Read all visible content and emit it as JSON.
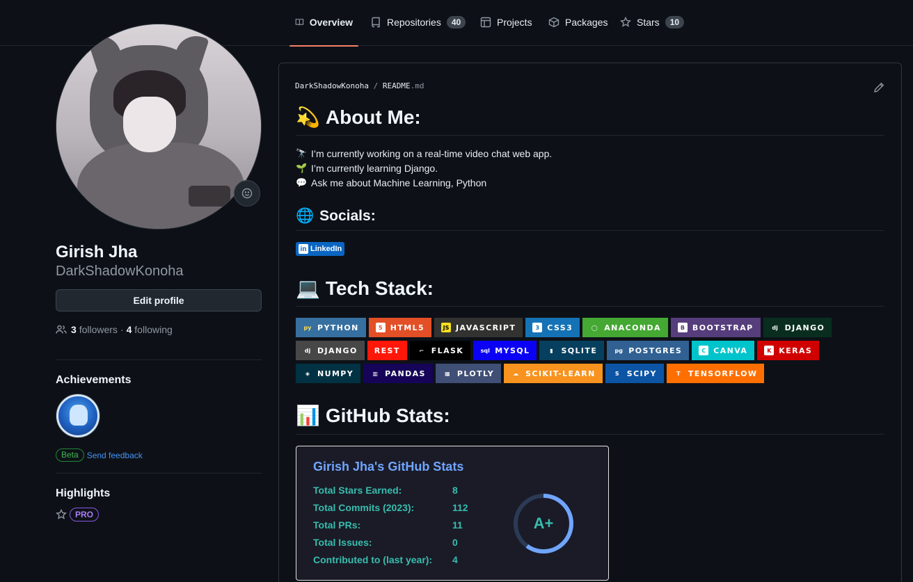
{
  "nav": {
    "tabs": [
      {
        "label": "Overview",
        "icon": "book-icon",
        "active": true
      },
      {
        "label": "Repositories",
        "icon": "repo-icon",
        "count": "40"
      },
      {
        "label": "Projects",
        "icon": "table-icon"
      },
      {
        "label": "Packages",
        "icon": "package-icon"
      },
      {
        "label": "Stars",
        "icon": "star-icon",
        "count": "10"
      }
    ]
  },
  "profile": {
    "name": "Girish Jha",
    "login": "DarkShadowKonoha",
    "edit_label": "Edit profile",
    "followers_count": "3",
    "followers_label": "followers",
    "separator": "·",
    "following_count": "4",
    "following_label": "following"
  },
  "achievements": {
    "heading": "Achievements",
    "beta_label": "Beta",
    "feedback_label": "Send feedback"
  },
  "highlights": {
    "heading": "Highlights",
    "pro_label": "PRO"
  },
  "readme": {
    "path_user": "DarkShadowKonoha",
    "path_sep": "/",
    "path_file": "README",
    "path_ext": ".md",
    "about_heading": "About Me:",
    "about_emoji": "💫",
    "lines": [
      {
        "icon": "🔭",
        "text": "I’m currently working on a real-time video chat web app."
      },
      {
        "icon": "🌱",
        "text": "I’m currently learning Django."
      },
      {
        "icon": "💬",
        "text": "Ask me about Machine Learning, Python"
      }
    ],
    "socials_heading": "Socials:",
    "socials_emoji": "🌐",
    "linkedin_label": "LinkedIn",
    "tech_heading": "Tech Stack:",
    "tech_emoji": "💻",
    "stats_heading": "GitHub Stats:",
    "stats_emoji": "📊"
  },
  "tech_badges": [
    {
      "label": "PYTHON",
      "bg": "#3670A0",
      "logo": "py",
      "logo_bg": "#3670A0",
      "logo_fg": "#ffdd54"
    },
    {
      "label": "HTML5",
      "bg": "#E34F26",
      "logo": "5",
      "logo_bg": "#ffffff",
      "logo_fg": "#E34F26"
    },
    {
      "label": "JAVASCRIPT",
      "bg": "#323330",
      "logo": "JS",
      "logo_bg": "#F7DF1E",
      "logo_fg": "#000000"
    },
    {
      "label": "CSS3",
      "bg": "#1572B6",
      "logo": "3",
      "logo_bg": "#ffffff",
      "logo_fg": "#1572B6"
    },
    {
      "label": "ANACONDA",
      "bg": "#44A833",
      "logo": "◯",
      "logo_bg": "#44A833",
      "logo_fg": "#ffffff"
    },
    {
      "label": "BOOTSTRAP",
      "bg": "#563D7C",
      "logo": "B",
      "logo_bg": "#ffffff",
      "logo_fg": "#563D7C"
    },
    {
      "label": "DJANGO",
      "bg": "#092E20",
      "logo": "dj",
      "logo_bg": "#092E20",
      "logo_fg": "#ffffff"
    },
    {
      "label": "DJANGO",
      "bg": "#474747",
      "logo": "dj",
      "logo_bg": "#474747",
      "logo_fg": "#ffffff"
    },
    {
      "label": "REST",
      "bg": "#ff1709",
      "logo": "",
      "logo_bg": "",
      "logo_fg": ""
    },
    {
      "label": "FLASK",
      "bg": "#000000",
      "logo": "⌐",
      "logo_bg": "#000000",
      "logo_fg": "#ffffff"
    },
    {
      "label": "MYSQL",
      "bg": "#0b02f5",
      "logo": "sql",
      "logo_bg": "#0b02f5",
      "logo_fg": "#ffffff"
    },
    {
      "label": "SQLITE",
      "bg": "#07405e",
      "logo": "▮",
      "logo_bg": "#07405e",
      "logo_fg": "#ffffff"
    },
    {
      "label": "POSTGRES",
      "bg": "#316192",
      "logo": "pg",
      "logo_bg": "#316192",
      "logo_fg": "#ffffff"
    },
    {
      "label": "CANVA",
      "bg": "#00C4CC",
      "logo": "C",
      "logo_bg": "#ffffff",
      "logo_fg": "#00C4CC"
    },
    {
      "label": "KERAS",
      "bg": "#D00000",
      "logo": "K",
      "logo_bg": "#ffffff",
      "logo_fg": "#D00000"
    },
    {
      "label": "NUMPY",
      "bg": "#013243",
      "logo": "◈",
      "logo_bg": "#013243",
      "logo_fg": "#ffffff"
    },
    {
      "label": "PANDAS",
      "bg": "#150458",
      "logo": "▥",
      "logo_bg": "#150458",
      "logo_fg": "#ffffff"
    },
    {
      "label": "PLOTLY",
      "bg": "#3F4F75",
      "logo": "▦",
      "logo_bg": "#3F4F75",
      "logo_fg": "#ffffff"
    },
    {
      "label": "SCIKIT-LEARN",
      "bg": "#F7931E",
      "logo": "☁",
      "logo_bg": "#F7931E",
      "logo_fg": "#ffffff"
    },
    {
      "label": "SCIPY",
      "bg": "#0C55A5",
      "logo": "S",
      "logo_bg": "#0C55A5",
      "logo_fg": "#ffffff"
    },
    {
      "label": "TENSORFLOW",
      "bg": "#FF6F00",
      "logo": "T",
      "logo_bg": "#FF6F00",
      "logo_fg": "#ffffff"
    }
  ],
  "stats_card": {
    "title": "Girish Jha's GitHub Stats",
    "rows": [
      {
        "label": "Total Stars Earned:",
        "value": "8"
      },
      {
        "label": "Total Commits (2023):",
        "value": "112"
      },
      {
        "label": "Total PRs:",
        "value": "11"
      },
      {
        "label": "Total Issues:",
        "value": "0"
      },
      {
        "label": "Contributed to (last year):",
        "value": "4"
      }
    ],
    "grade": "A+",
    "grade_fraction": 0.6,
    "ring_color": "#70a5fd",
    "text_color": "#38bdae"
  }
}
